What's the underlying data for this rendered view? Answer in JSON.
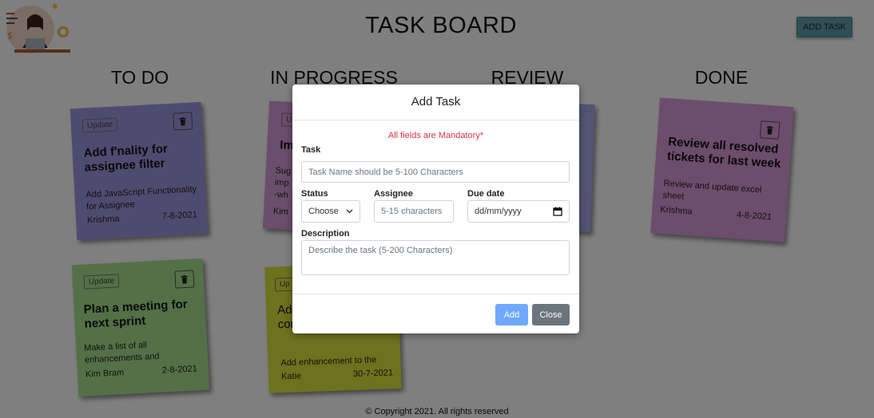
{
  "header": {
    "title": "TASK BOARD",
    "add_task_label": "ADD TASK"
  },
  "columns": [
    "TO DO",
    "IN PROGRESS",
    "REVIEW",
    "DONE"
  ],
  "notes": [
    {
      "update_label": "Update",
      "title": "Add f'nality for assignee filter",
      "description": "Add JavaScript Functionality for Assignee",
      "assignee": "Krishma",
      "date": "7-8-2021",
      "color": "#9f97e0"
    },
    {
      "update_label": "U",
      "title": "Im",
      "description": "Sug imp -wh",
      "assignee": "Kim",
      "date": "",
      "color": "#d79bd8"
    },
    {
      "update_label": "",
      "title": "",
      "description": "",
      "assignee": "",
      "date": "",
      "color": "#a9a8e6"
    },
    {
      "update_label": "",
      "title": "Review all resolved tickets for last week",
      "description": "Review and update excel sheet",
      "assignee": "Krishma",
      "date": "4-8-2021",
      "color": "#d99ad8"
    },
    {
      "update_label": "Update",
      "title": "Plan a meeting for next sprint",
      "description": "Make a list of all enhancements and",
      "assignee": "Kim Bram",
      "date": "2-8-2021",
      "color": "#a8e08f"
    },
    {
      "update_label": "Up",
      "title": "Ad to component",
      "description": "Add enhancement to the",
      "assignee": "Katie",
      "date": "30-7-2021",
      "color": "#dce33b"
    }
  ],
  "modal": {
    "title": "Add Task",
    "mandatory_note": "All fields are Mandatory*",
    "task_label": "Task",
    "task_placeholder": "Task Name should be 5-100 Characters",
    "status_label": "Status",
    "status_value": "Choose",
    "assignee_label": "Assignee",
    "assignee_placeholder": "5-15 characters",
    "due_label": "Due date",
    "due_value": "dd/mm/yyyy",
    "description_label": "Description",
    "description_placeholder": "Describe the task (5-200 Characters)",
    "add_label": "Add",
    "close_label": "Close"
  },
  "footer": {
    "text": "© Copyright 2021. All rights reserved"
  }
}
